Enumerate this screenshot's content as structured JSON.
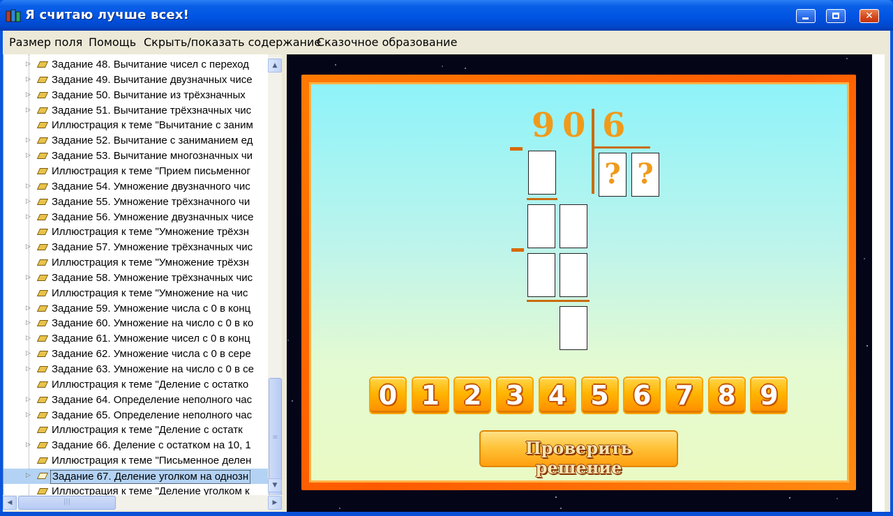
{
  "window": {
    "title": "Я считаю лучше всех!"
  },
  "menu": [
    {
      "label": "Размер поля"
    },
    {
      "label": "Помощь"
    },
    {
      "label": "Скрыть/показать содержание"
    },
    {
      "label": "Сказочное образование"
    }
  ],
  "tree": {
    "items": [
      {
        "label": "Задание 48. Вычитание чисел с переход",
        "expandable": true
      },
      {
        "label": "Задание 49. Вычитание двузначных чисе",
        "expandable": true
      },
      {
        "label": "Задание 50. Вычитание из трёхзначных",
        "expandable": true
      },
      {
        "label": "Задание 51. Вычитание трёхзначных чис",
        "expandable": true
      },
      {
        "label": "Иллюстрация к теме \"Вычитание с заним",
        "expandable": false
      },
      {
        "label": "Задание 52. Вычитание с заниманием ед",
        "expandable": true
      },
      {
        "label": "Задание 53. Вычитание многозначных чи",
        "expandable": true
      },
      {
        "label": "Иллюстрация к теме \"Прием письменног",
        "expandable": false
      },
      {
        "label": "Задание 54. Умножение двузначного чис",
        "expandable": true
      },
      {
        "label": "Задание 55. Умножение трёхзначного чи",
        "expandable": true
      },
      {
        "label": "Задание 56. Умножение двузначных чисе",
        "expandable": true
      },
      {
        "label": "Иллюстрация к теме \"Умножение трёхзн",
        "expandable": false
      },
      {
        "label": "Задание 57. Умножение трёхзначных чис",
        "expandable": true
      },
      {
        "label": "Иллюстрация к теме \"Умножение трёхзн",
        "expandable": false
      },
      {
        "label": "Задание 58. Умножение трёхзначных чис",
        "expandable": true
      },
      {
        "label": "Иллюстрация к теме \"Умножение на чис",
        "expandable": false
      },
      {
        "label": "Задание 59. Умножение числа с 0 в конц",
        "expandable": true
      },
      {
        "label": "Задание 60. Умножение на число с 0 в ко",
        "expandable": true
      },
      {
        "label": "Задание 61. Умножение чисел с 0 в конц",
        "expandable": true
      },
      {
        "label": "Задание 62. Умножение числа с 0 в сере",
        "expandable": true
      },
      {
        "label": "Задание 63. Умножение на число с 0 в се",
        "expandable": true
      },
      {
        "label": "Иллюстрация к теме \"Деление с остатко",
        "expandable": false
      },
      {
        "label": "Задание 64. Определение неполного час",
        "expandable": true
      },
      {
        "label": "Задание 65. Определение неполного час",
        "expandable": true
      },
      {
        "label": "Иллюстрация к теме \"Деление с остатк",
        "expandable": false
      },
      {
        "label": "Задание 66. Деление с остатком на 10, 1",
        "expandable": true
      },
      {
        "label": "Иллюстрация к теме \"Письменное делен",
        "expandable": false
      },
      {
        "label": "Задание 67. Деление уголком на однозн",
        "expandable": true,
        "selected": true
      },
      {
        "label": "Иллюстрация к теме \"Деление уголком к",
        "expandable": false
      }
    ]
  },
  "problem": {
    "dividend_digits": [
      "9",
      "0"
    ],
    "divisor": "6",
    "quotient_placeholders": [
      "?",
      "?"
    ]
  },
  "keypad": {
    "digits": [
      "0",
      "1",
      "2",
      "3",
      "4",
      "5",
      "6",
      "7",
      "8",
      "9"
    ]
  },
  "check_button": {
    "label": "Проверить решение"
  },
  "colors": {
    "frame_orange": "#ff6a00",
    "digit_orange": "#f09a1a",
    "board_top": "#8ef3f9",
    "board_bottom": "#eafac4"
  }
}
